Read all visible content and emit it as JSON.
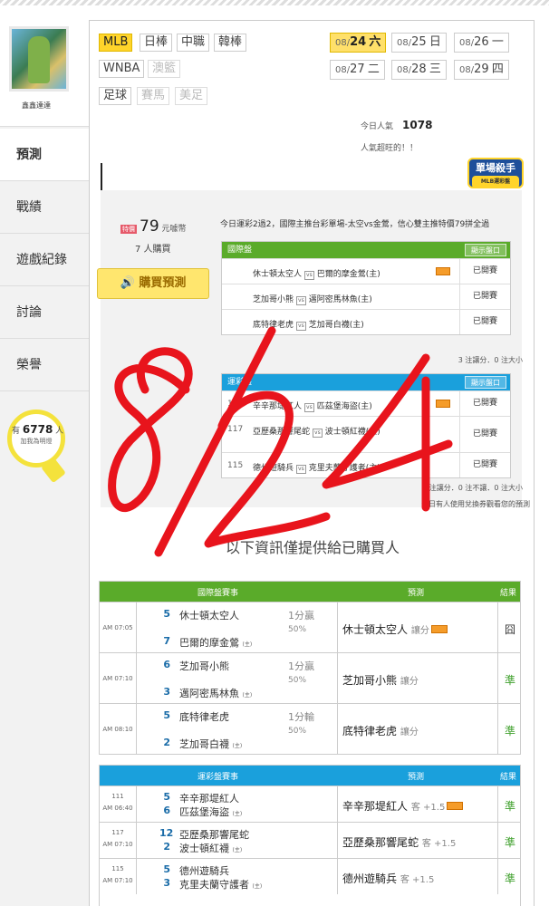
{
  "user": {
    "name": "鑫鑫達達"
  },
  "nav": {
    "items": [
      {
        "label": "預測"
      },
      {
        "label": "戰績"
      },
      {
        "label": "遊戲紀錄"
      },
      {
        "label": "討論"
      },
      {
        "label": "榮譽"
      }
    ]
  },
  "bulb": {
    "prefix": "有",
    "count": "6778",
    "suffix": "人",
    "sub": "加我為明燈"
  },
  "sports": [
    "MLB",
    "日棒",
    "中職",
    "韓棒",
    "WNBA",
    "澳籃",
    "足球",
    "賽馬",
    "美足"
  ],
  "dates": [
    {
      "md": "08/",
      "day": "24",
      "wd": "六"
    },
    {
      "md": "08/",
      "day": "25",
      "wd": "日"
    },
    {
      "md": "08/",
      "day": "26",
      "wd": "一"
    },
    {
      "md": "08/",
      "day": "27",
      "wd": "二"
    },
    {
      "md": "08/",
      "day": "28",
      "wd": "三"
    },
    {
      "md": "08/",
      "day": "29",
      "wd": "四"
    }
  ],
  "popularity": {
    "label": "今日人氣",
    "value": "1078",
    "sub": "人氣超旺的！！"
  },
  "badge": {
    "title": "單場殺手",
    "sub": "MLB運彩盤"
  },
  "prediction": {
    "hot": "特價",
    "price": "79",
    "unit": "元噱幣",
    "buyers": "7 人購買",
    "buy_button": "購買預測",
    "desc": "今日運彩2過2，國際主推台彩單場-太空vs金鶯，信心雙主推特價79拼全過",
    "intl_header": "國際盤",
    "show_label": "顯示盤口",
    "intl_rows": [
      {
        "away": "休士頓太空人",
        "home": "巴爾的摩金鶯(主)",
        "status": "已開賽"
      },
      {
        "away": "芝加哥小熊",
        "home": "邁阿密馬林魚(主)",
        "status": "已開賽"
      },
      {
        "away": "底特律老虎",
        "home": "芝加哥白襪(主)",
        "status": "已開賽"
      }
    ],
    "intl_note": "3 注讓分．0 注大小",
    "tw_header": "運彩盤",
    "tw_rows": [
      {
        "num": "111",
        "away": "辛辛那堤紅人",
        "home": "匹茲堡海盜(主)",
        "status": "已開賽"
      },
      {
        "num": "117",
        "away": "亞歷桑那響尾蛇",
        "home": "波士頓紅襪(主)",
        "status": "已開賽"
      },
      {
        "num": "115",
        "away": "德州遊騎兵",
        "home": "克里夫蘭守護者(主)",
        "status": "已開賽"
      }
    ],
    "tw_note": "3 注讓分．0 注不讓．0 注大小",
    "usage_note": "今日有人使用兌換券觀看您的預測"
  },
  "info_title": "以下資訊僅提供給已購買人",
  "intl_table": {
    "title": "國際盤賽事",
    "pick": "預測",
    "result": "結果",
    "rows": [
      {
        "time": "AM 07:05",
        "s1": "5",
        "t1": "休士頓太空人",
        "s2": "7",
        "t2": "巴爾的摩金鶯",
        "h": "(主)",
        "hc1": "1分贏",
        "hc2": "50%",
        "pick": "休士頓太空人",
        "type": "讓分",
        "res": "囧"
      },
      {
        "time": "AM 07:10",
        "s1": "6",
        "t1": "芝加哥小熊",
        "s2": "3",
        "t2": "邁阿密馬林魚",
        "h": "(主)",
        "hc1": "1分贏",
        "hc2": "50%",
        "pick": "芝加哥小熊",
        "type": "讓分",
        "res": "準"
      },
      {
        "time": "AM 08:10",
        "s1": "5",
        "t1": "底特律老虎",
        "s2": "2",
        "t2": "芝加哥白襪",
        "h": "(主)",
        "hc1": "1分輸",
        "hc2": "50%",
        "pick": "底特律老虎",
        "type": "讓分",
        "res": "準"
      }
    ]
  },
  "tw_table": {
    "title": "運彩盤賽事",
    "pick": "預測",
    "result": "結果",
    "rows": [
      {
        "num": "111",
        "time": "AM 06:40",
        "s1": "5",
        "t1": "辛辛那堤紅人",
        "s2": "6",
        "t2": "匹茲堡海盜",
        "h": "(主)",
        "pick": "辛辛那堤紅人",
        "type": "客 +1.5",
        "res": "準"
      },
      {
        "num": "117",
        "time": "AM 07:10",
        "s1": "12",
        "t1": "亞歷桑那響尾蛇",
        "s2": "2",
        "t2": "波士頓紅襪",
        "h": "(主)",
        "pick": "亞歷桑那響尾蛇",
        "type": "客 +1.5",
        "res": "準"
      },
      {
        "num": "115",
        "time": "AM 07:10",
        "s1": "5",
        "t1": "德州遊騎兵",
        "s2": "3",
        "t2": "克里夫蘭守護者",
        "h": "(主)",
        "pick": "德州遊騎兵",
        "type": "客 +1.5",
        "res": "準"
      }
    ]
  },
  "handwriting": "8/24",
  "colors": {
    "green": "#5aab2a",
    "blue": "#1aa0dc",
    "yellow": "#ffd42a",
    "red_ink": "#e8141c"
  }
}
